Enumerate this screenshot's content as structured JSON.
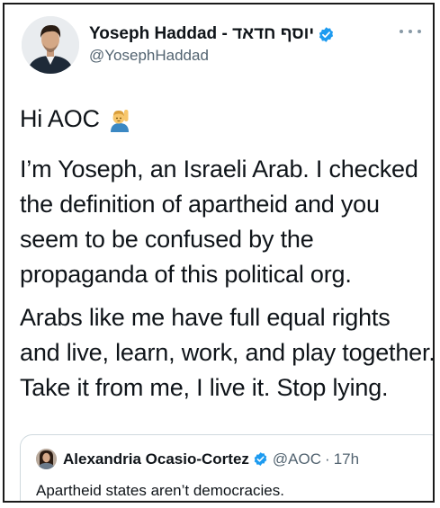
{
  "tweet": {
    "author": {
      "display_name": "Yoseph Haddad - יוסף חדאד",
      "handle": "@YosephHaddad",
      "verified": true,
      "avatar_icon": "profile-photo"
    },
    "menu_icon": "more-options-icon",
    "greeting": "Hi AOC",
    "greeting_emoji": "person-raising-hand-emoji",
    "paragraphs": [
      "I’m Yoseph, an Israeli Arab. I checked the definition of apartheid and you seem to be confused by the propaganda of this political org.",
      "Arabs like me have full equal rights and live, learn, work, and play together. Take it from me, I live it. Stop lying."
    ],
    "quoted_tweet": {
      "display_name": "Alexandria Ocasio-Cortez",
      "handle": "@AOC",
      "separator": "·",
      "time": "17h",
      "verified": true,
      "text": "Apartheid states aren’t democracies."
    }
  },
  "colors": {
    "text": "#0f1419",
    "secondary": "#536471",
    "verified": "#1d9bf0",
    "border": "#cfd9de"
  }
}
